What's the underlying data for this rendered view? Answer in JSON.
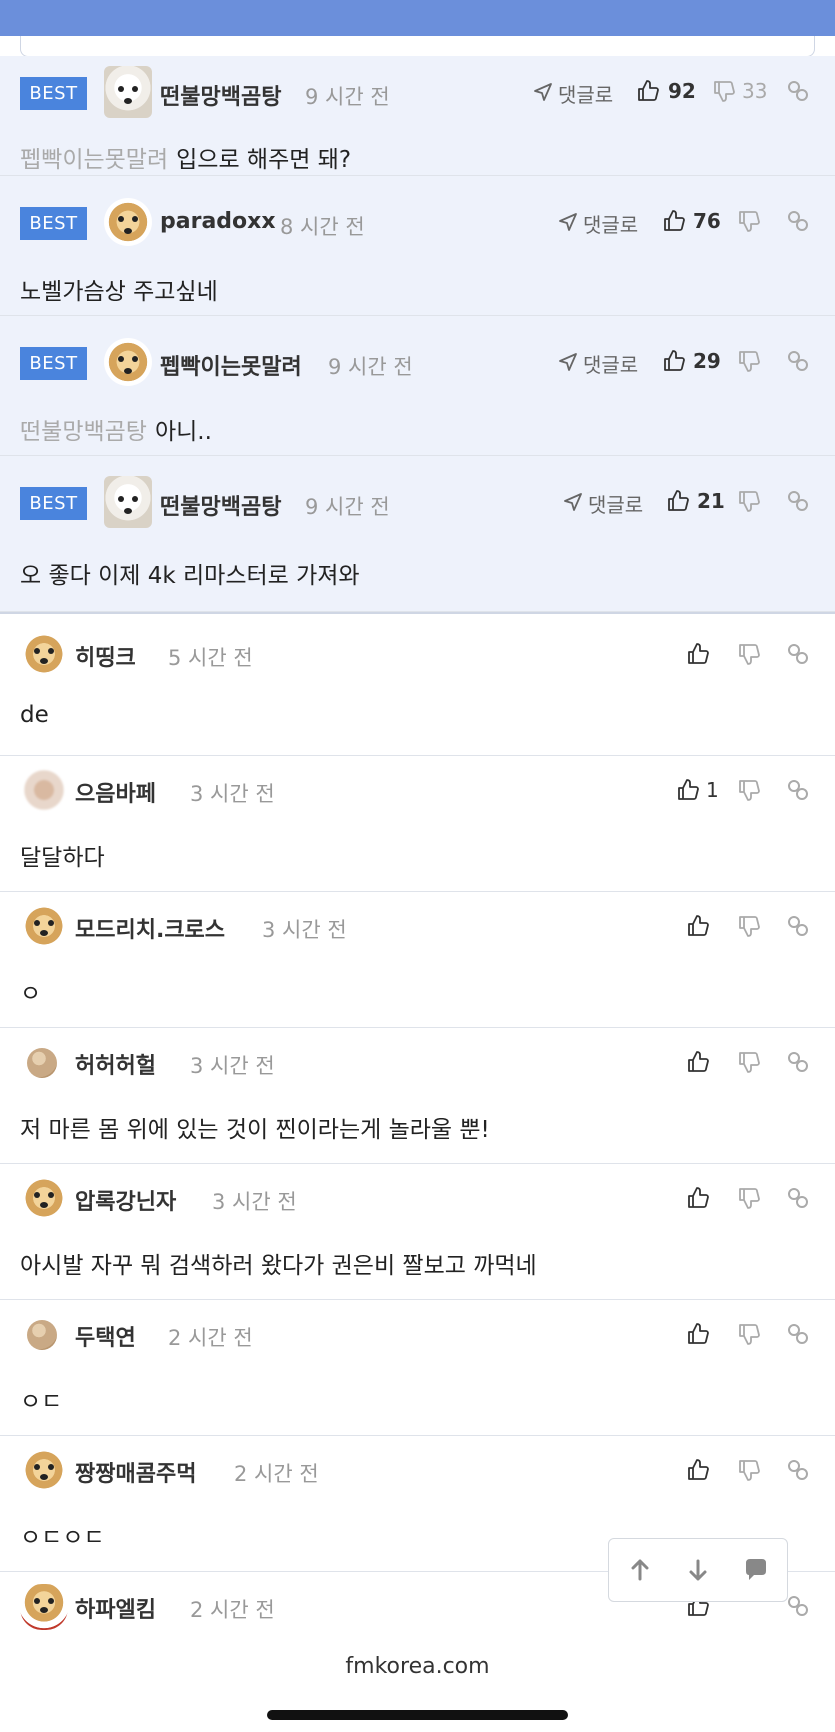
{
  "colors": {
    "topbar": "#6b8fdb",
    "badge": "#4a84dd",
    "best_bg": "#eef2fb",
    "icon": "#666666"
  },
  "best_comments": [
    {
      "badge": "BEST",
      "nickname": "떤불망백곰탕",
      "time": "9 시간 전",
      "reply_label": "댓글로",
      "likes": "92",
      "dislikes": "33",
      "mention": "펩빡이는못말려",
      "text": "입으로 해주면 돼?"
    },
    {
      "badge": "BEST",
      "nickname": "paradoxx",
      "time": "8 시간 전",
      "reply_label": "댓글로",
      "likes": "76",
      "dislikes": "",
      "mention": "",
      "text": "노벨가슴상 주고싶네"
    },
    {
      "badge": "BEST",
      "nickname": "펩빡이는못말려",
      "time": "9 시간 전",
      "reply_label": "댓글로",
      "likes": "29",
      "dislikes": "",
      "mention": "떤불망백곰탕",
      "text": "아니.."
    },
    {
      "badge": "BEST",
      "nickname": "떤불망백곰탕",
      "time": "9 시간 전",
      "reply_label": "댓글로",
      "likes": "21",
      "dislikes": "",
      "mention": "",
      "text": "오 좋다 이제 4k 리마스터로 가져와"
    }
  ],
  "comments": [
    {
      "nickname": "히띵크",
      "time": "5 시간 전",
      "likes": "",
      "text": "de"
    },
    {
      "nickname": "으음바페",
      "time": "3 시간 전",
      "likes": "1",
      "text": "달달하다"
    },
    {
      "nickname": "모드리치.크로스",
      "time": "3 시간 전",
      "likes": "",
      "text": "ㅇ"
    },
    {
      "nickname": "허허허헐",
      "time": "3 시간 전",
      "likes": "",
      "text": "저 마른 몸 위에 있는 것이 찐이라는게 놀라울 뿐!"
    },
    {
      "nickname": "압록강닌자",
      "time": "3 시간 전",
      "likes": "",
      "text": "아시발 자꾸 뭐 검색하러 왔다가 권은비 짤보고 까먹네"
    },
    {
      "nickname": "두택연",
      "time": "2 시간 전",
      "likes": "",
      "text": "ㅇㄷ"
    },
    {
      "nickname": "짱짱매콤주먹",
      "time": "2 시간 전",
      "likes": "",
      "text": "ㅇㄷㅇㄷ"
    },
    {
      "nickname": "하파엘킴",
      "time": "2 시간 전",
      "likes": "",
      "text": ""
    }
  ],
  "footer": {
    "url": "fmkorea.com"
  }
}
